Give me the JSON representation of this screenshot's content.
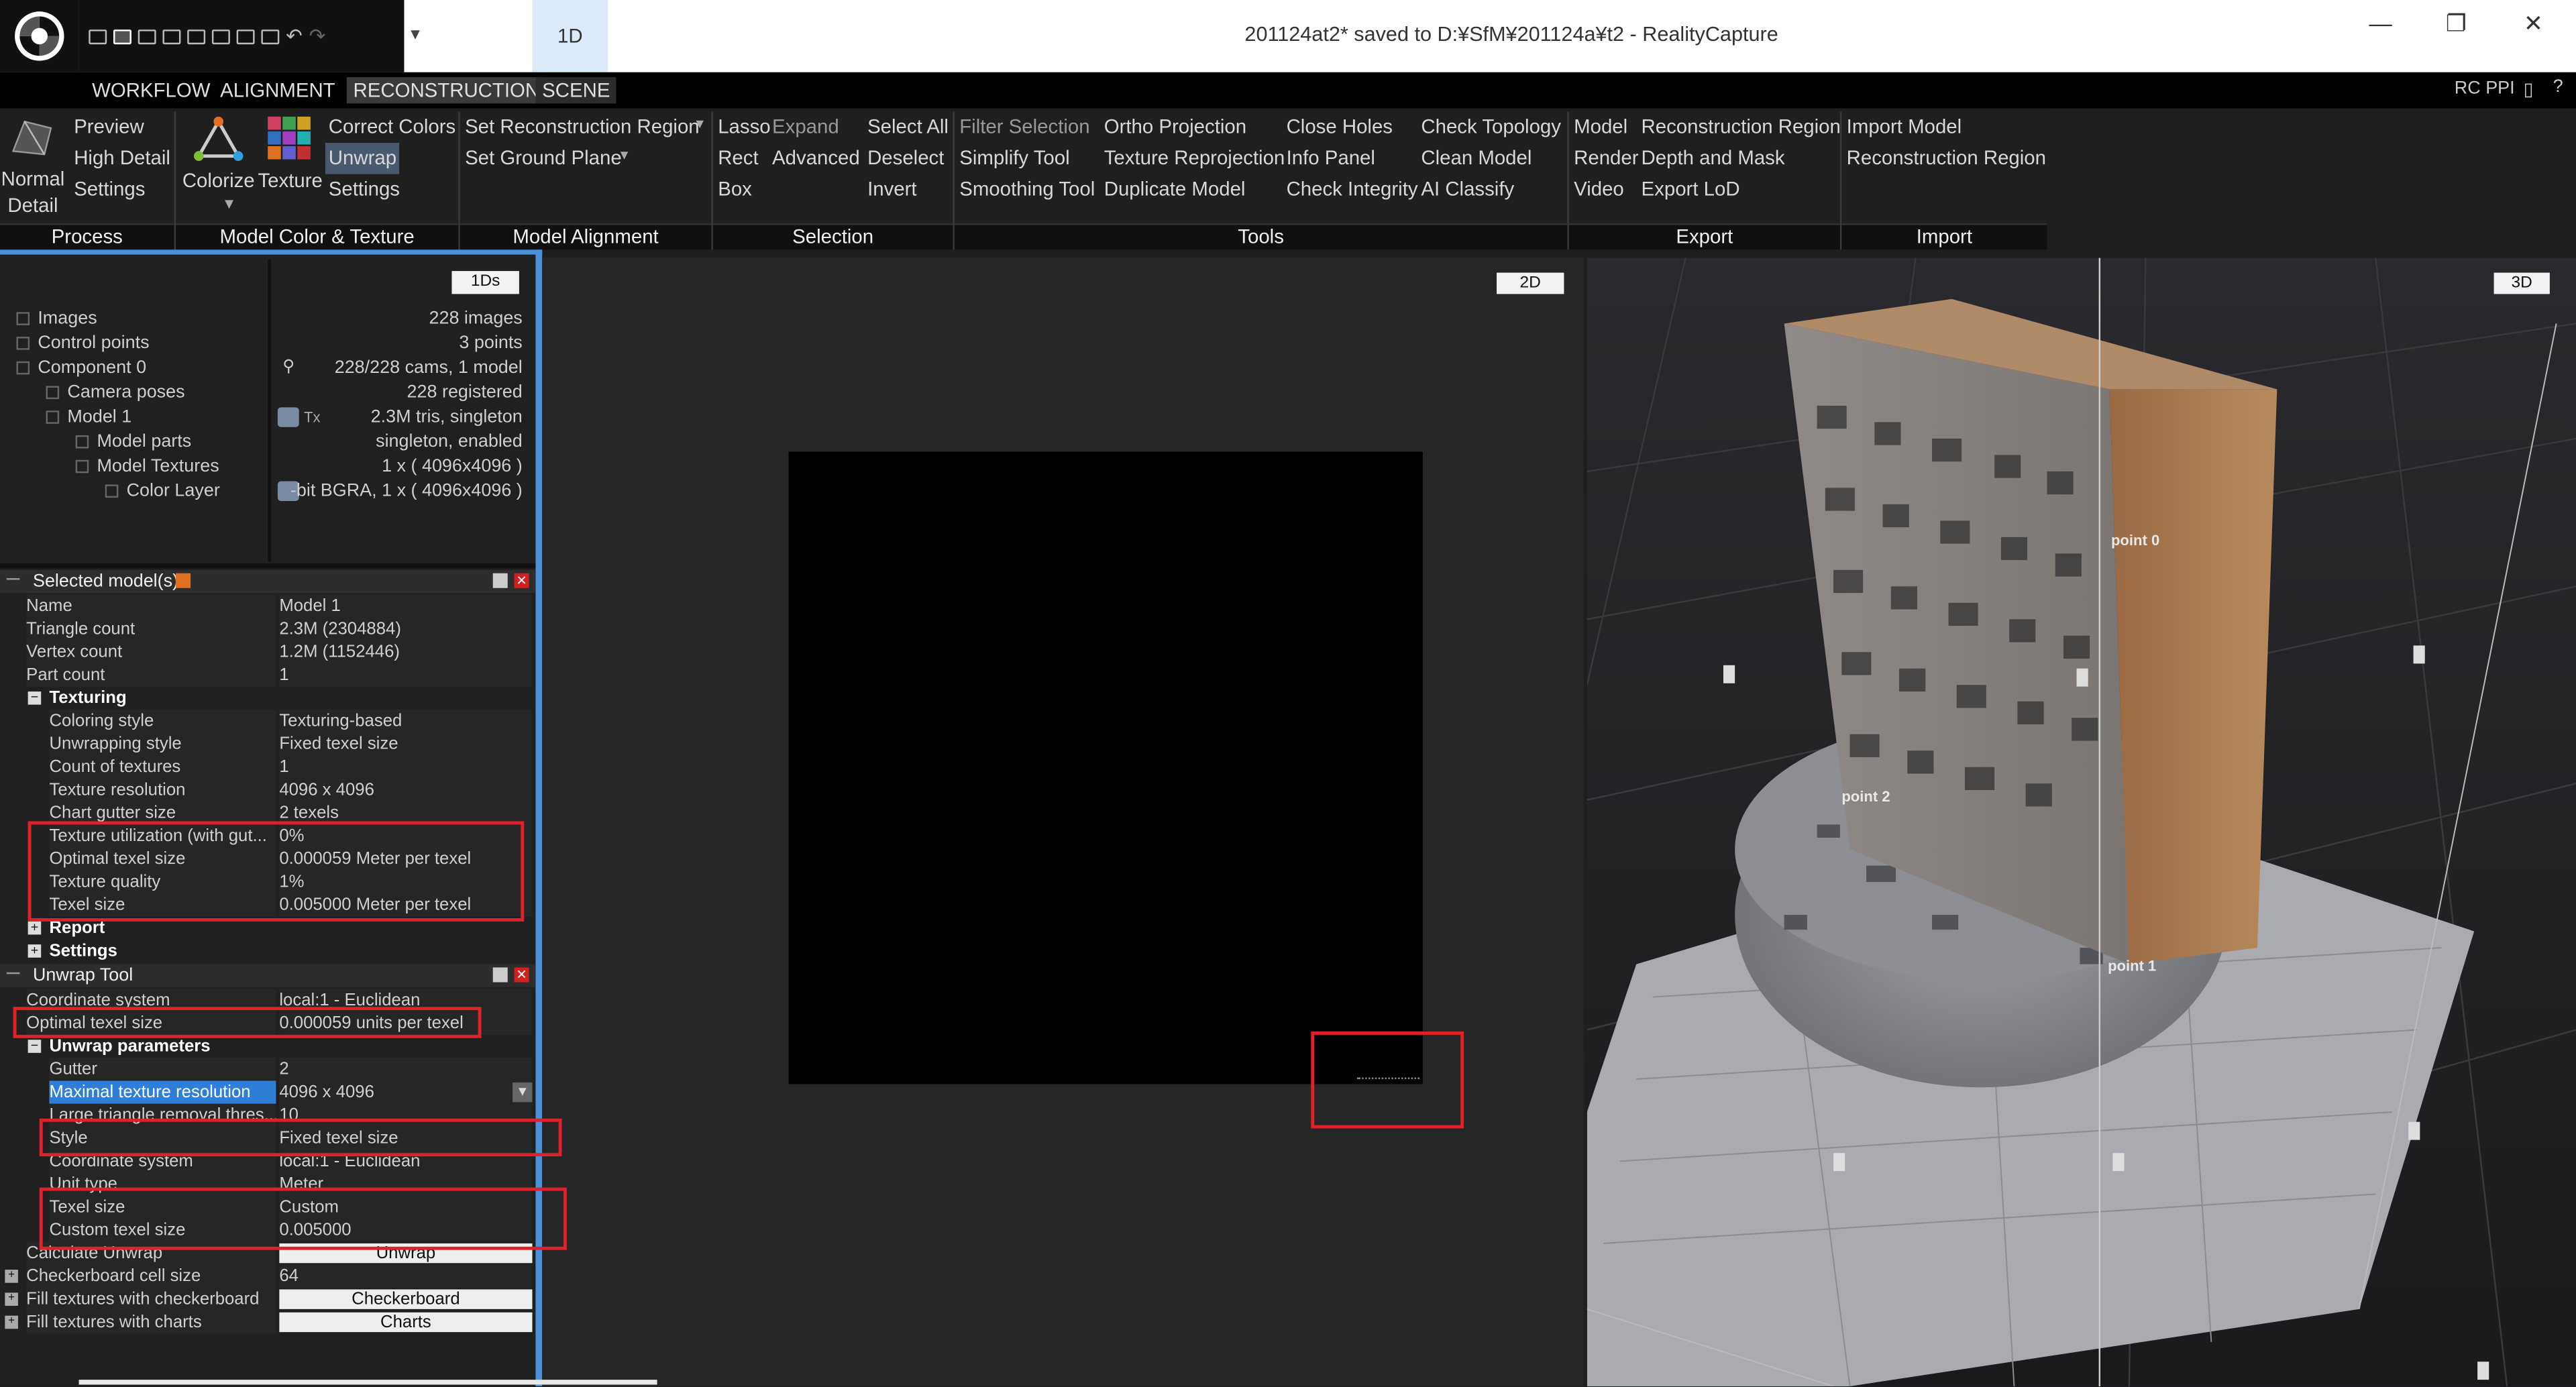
{
  "window": {
    "title": "201124at2* saved to D:¥SfM¥201124a¥t2 - RealityCapture",
    "layout_tab": "1D",
    "controls": {
      "minimize": "—",
      "restore": "❐",
      "close": "✕"
    }
  },
  "menu": {
    "tabs": [
      "WORKFLOW",
      "ALIGNMENT",
      "RECONSTRUCTION",
      "SCENE"
    ],
    "active": "RECONSTRUCTION",
    "right": "RC PPI"
  },
  "ribbon": {
    "process": {
      "normal_detail": "Normal\nDetail",
      "preview": "Preview",
      "high_detail": "High Detail",
      "settings": "Settings",
      "group": "Process"
    },
    "color_texture": {
      "colorize": "Colorize",
      "texture": "Texture",
      "correct_colors": "Correct Colors",
      "unwrap": "Unwrap",
      "settings": "Settings",
      "group": "Model Color & Texture"
    },
    "alignment": {
      "set_region": "Set Reconstruction Region",
      "set_ground": "Set Ground Plane",
      "group": "Model Alignment"
    },
    "selection": {
      "lasso": "Lasso",
      "expand": "Expand",
      "rect": "Rect",
      "advanced": "Advanced",
      "box": "Box",
      "select_all": "Select All",
      "deselect": "Deselect",
      "invert": "Invert",
      "group": "Selection"
    },
    "tools": {
      "filter_selection": "Filter Selection",
      "simplify_tool": "Simplify Tool",
      "smoothing_tool": "Smoothing Tool",
      "ortho_projection": "Ortho Projection",
      "texture_reprojection": "Texture Reprojection",
      "duplicate_model": "Duplicate Model",
      "close_holes": "Close Holes",
      "info_panel": "Info Panel",
      "check_integrity": "Check Integrity",
      "check_topology": "Check Topology",
      "clean_model": "Clean Model",
      "ai_classify": "AI Classify",
      "group": "Tools"
    },
    "export": {
      "model": "Model",
      "render": "Render",
      "video": "Video",
      "reconstruction_region": "Reconstruction Region",
      "depth_and_mask": "Depth and Mask",
      "export_lod": "Export LoD",
      "group": "Export"
    },
    "import": {
      "import_model": "Import Model",
      "reconstruction_region": "Reconstruction Region",
      "group": "Import"
    }
  },
  "tree": {
    "tab": "1Ds",
    "items": [
      {
        "label": "Images",
        "value": "228 images"
      },
      {
        "label": "Control points",
        "value": "3 points"
      },
      {
        "label": "Component 0",
        "value": "228/228 cams, 1 model"
      },
      {
        "label": "Camera poses",
        "value": "228 registered"
      },
      {
        "label": "Model 1",
        "value": "2.3M tris, singleton"
      },
      {
        "label": "Model parts",
        "value": "singleton, enabled"
      },
      {
        "label": "Model Textures",
        "value": "1 x ( 4096x4096 )"
      },
      {
        "label": "Color Layer",
        "value": "-bit BGRA, 1 x ( 4096x4096 )"
      }
    ],
    "tx_label": "Tx"
  },
  "selected_model": {
    "header": "Selected model(s)",
    "rows": [
      [
        "Name",
        "Model 1"
      ],
      [
        "Triangle count",
        "2.3M (2304884)"
      ],
      [
        "Vertex count",
        "1.2M (1152446)"
      ],
      [
        "Part count",
        "1"
      ]
    ],
    "texturing_label": "Texturing",
    "texturing_rows": [
      [
        "Coloring style",
        "Texturing-based"
      ],
      [
        "Unwrapping style",
        "Fixed texel size"
      ],
      [
        "Count of textures",
        "1"
      ],
      [
        "Texture resolution",
        "4096 x 4096"
      ],
      [
        "Chart gutter size",
        "2 texels"
      ],
      [
        "Texture utilization (with gut...",
        "0%"
      ],
      [
        "Optimal texel size",
        "0.000059 Meter per texel"
      ],
      [
        "Texture quality",
        "1%"
      ],
      [
        "Texel size",
        "0.005000 Meter per texel"
      ]
    ],
    "report_label": "Report",
    "settings_label": "Settings"
  },
  "unwrap_tool": {
    "header": "Unwrap Tool",
    "rows": [
      [
        "Coordinate system",
        "local:1 - Euclidean"
      ],
      [
        "Optimal texel size",
        "0.000059 units per texel"
      ]
    ],
    "params_label": "Unwrap parameters",
    "param_rows": [
      [
        "Gutter",
        "2"
      ],
      [
        "Maximal texture resolution",
        "4096 x 4096"
      ],
      [
        "Large triangle removal thres...",
        "10"
      ],
      [
        "Style",
        "Fixed texel size"
      ],
      [
        "Coordinate system",
        "local:1 - Euclidean"
      ],
      [
        "Unit type",
        "Meter"
      ],
      [
        "Texel size",
        "Custom"
      ],
      [
        "Custom texel size",
        "0.005000"
      ]
    ],
    "calc_label": "Calculate Unwrap",
    "calc_button": "Unwrap",
    "checker_label": "Checkerboard cell size",
    "checker_value": "64",
    "fill_checker_label": "Fill textures with checkerboard",
    "fill_checker_button": "Checkerboard",
    "fill_charts_label": "Fill textures with charts",
    "fill_charts_button": "Charts"
  },
  "view2d": {
    "tab": "2D"
  },
  "view3d": {
    "tab": "3D",
    "points": [
      "point 0",
      "point 1",
      "point 2"
    ]
  }
}
